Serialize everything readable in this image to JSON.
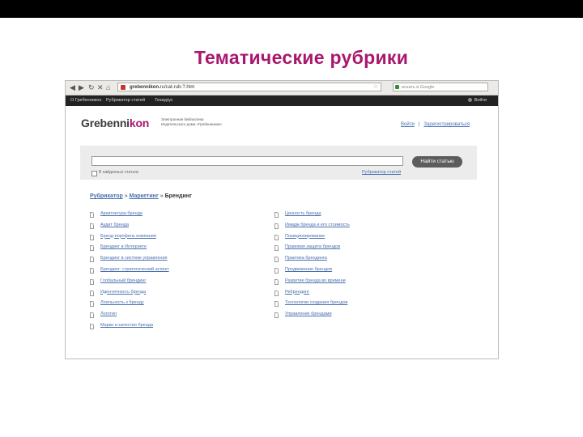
{
  "slide": {
    "title": "Тематические рубрики"
  },
  "browser": {
    "nav_back": "◀",
    "nav_forward": "▶",
    "nav_reload": "↻",
    "nav_stop": "✕",
    "nav_home": "⌂",
    "url_domain": "grebennikon.",
    "url_rest": "ru/cat-rub-?.htm",
    "search_placeholder": "искать в Google"
  },
  "site_nav": {
    "items": [
      "О Гребенникон",
      "Рубрикатор статей",
      "Тезаурус"
    ],
    "login_label": "Войти"
  },
  "header": {
    "logo_main": "Grebenni",
    "logo_accent": "kon",
    "tagline_line1": "Электронная библиотека",
    "tagline_line2": "Издательского дома «Гребенников»",
    "link_login": "Войти",
    "link_separator": "|",
    "link_register": "Зарегистрироваться"
  },
  "search": {
    "button_label": "Найти статью",
    "checkbox_label": "В найденных статьях",
    "rubric_link": "Рубрикатор статей"
  },
  "breadcrumb": {
    "rubricator": "Рубрикатор",
    "sep1": " » ",
    "marketing": "Маркетинг",
    "sep2": " » ",
    "current": "Брендинг"
  },
  "rubrics_left": [
    "Архитектура бренда",
    "Аудит бренда",
    "Бренд-портфель компании",
    "Брендинг в Интернете",
    "Брендинг в системе управления",
    "Брендинг: стратегический аспект",
    "Глобальный брендинг",
    "Идентичность бренда",
    "Лояльность к бренду",
    "Логотип",
    "Марки и качество бренда"
  ],
  "rubrics_right": [
    "Ценность бренда",
    "Имидж бренда и его стоимость",
    "Позиционирование",
    "Правовая защита брендов",
    "Практика брендинга",
    "Продвижение брендов",
    "Развитие бренда во времени",
    "Ребрендинг",
    "Технологии создания брендов",
    "Управление брендами"
  ]
}
